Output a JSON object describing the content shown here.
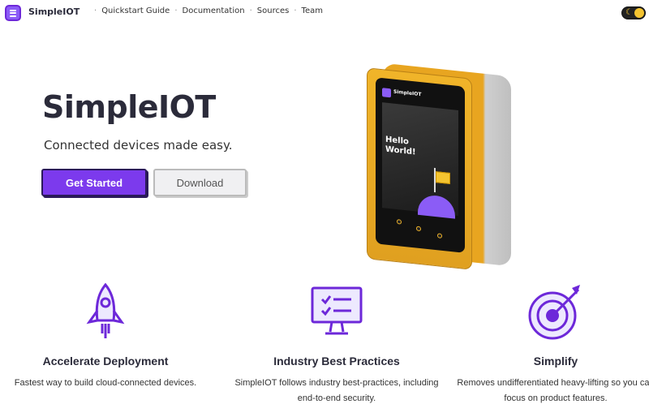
{
  "nav": {
    "brand": "SimpleIOT",
    "links": [
      "Quickstart Guide",
      "Documentation",
      "Sources",
      "Team"
    ],
    "logo_icon": "simpleiot-logo-icon",
    "theme_toggle_icon": "moon-icon"
  },
  "hero": {
    "title": "SimpleIOT",
    "subtitle": "Connected devices made easy.",
    "primary_button": "Get Started",
    "secondary_button": "Download"
  },
  "device_screen": {
    "brand": "SimpleIOT",
    "text": "Hello World!"
  },
  "features": [
    {
      "icon": "rocket-icon",
      "title": "Accelerate Deployment",
      "description": "Fastest way to build cloud-connected devices."
    },
    {
      "icon": "monitor-checklist-icon",
      "title": "Industry Best Practices",
      "description": "SimpleIOT follows industry best-practices, including end-to-end security."
    },
    {
      "icon": "target-icon",
      "title": "Simplify",
      "description": "Removes undifferentiated heavy-lifting so you can focus on product features."
    }
  ],
  "colors": {
    "accent": "#7c3aed",
    "device_body": "#e8a520"
  }
}
